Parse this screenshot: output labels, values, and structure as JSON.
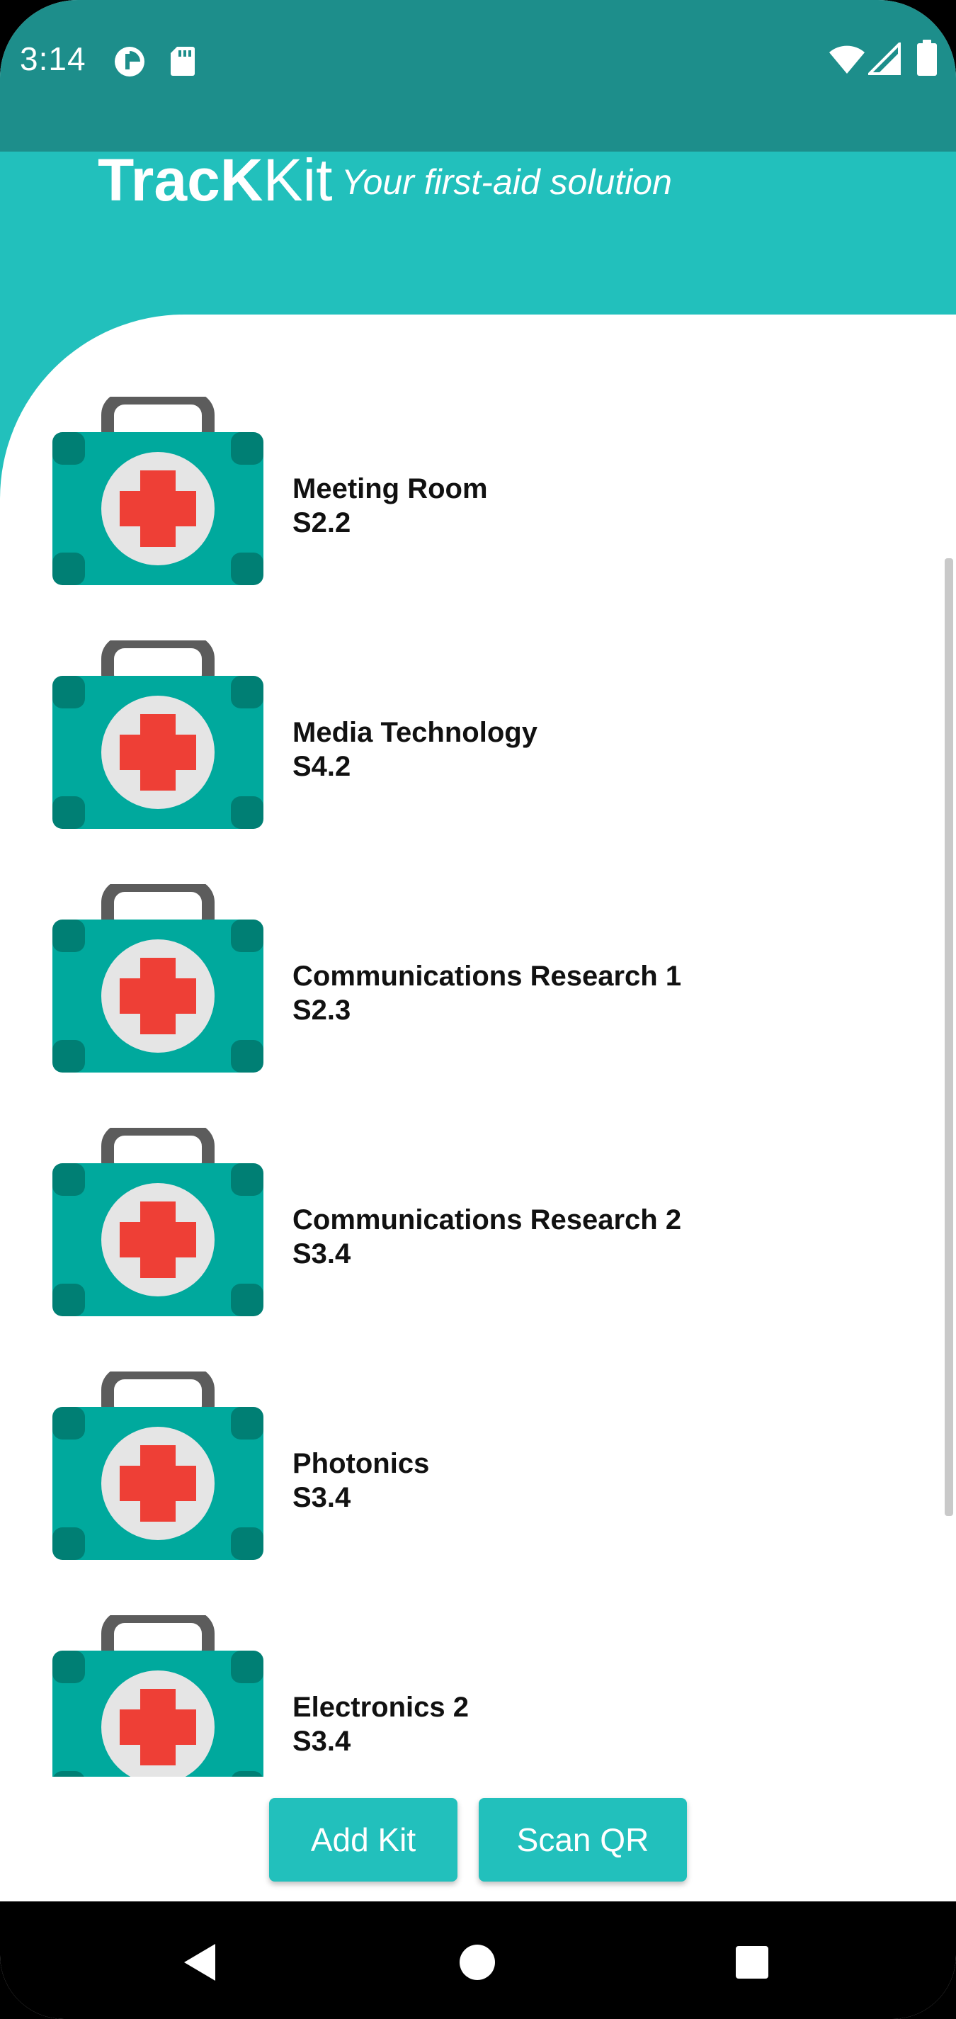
{
  "status_bar": {
    "time": "3:14",
    "left_icons": [
      "data-saver-icon",
      "sd-card-icon"
    ],
    "right_icons": [
      "wifi-icon",
      "cell-signal-icon",
      "battery-icon"
    ]
  },
  "header": {
    "brand_bold": "TracK",
    "brand_light": "Kit",
    "tagline": "Your first-aid solution"
  },
  "kits": [
    {
      "name": "Meeting Room",
      "location": "S2.2"
    },
    {
      "name": "Media Technology",
      "location": "S4.2"
    },
    {
      "name": "Communications Research 1",
      "location": "S2.3"
    },
    {
      "name": "Communications Research 2",
      "location": "S3.4"
    },
    {
      "name": "Photonics",
      "location": "S3.4"
    },
    {
      "name": "Electronics 2",
      "location": "S3.4"
    }
  ],
  "actions": {
    "add_kit": "Add Kit",
    "scan_qr": "Scan QR"
  },
  "nav": {
    "icons": [
      "back-icon",
      "home-icon",
      "recents-icon"
    ]
  },
  "colors": {
    "status_bar": "#1d8e8b",
    "accent": "#22c0bc",
    "kit_body": "#00a99d",
    "kit_corner": "#007f74",
    "kit_handle": "#5c5c5c",
    "cross": "#ee3f36"
  }
}
